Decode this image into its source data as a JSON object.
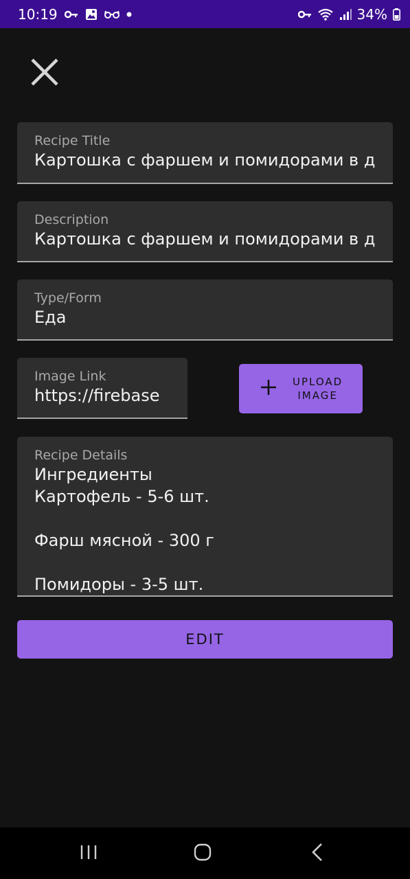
{
  "status_bar": {
    "time": "10:19",
    "battery": "34%",
    "icons_left": [
      "key-icon",
      "image-icon",
      "glasses-icon",
      "dot-icon"
    ],
    "icons_right": [
      "key-icon",
      "wifi-icon",
      "signal-icon",
      "battery-icon"
    ],
    "background_color": "#3b0e91"
  },
  "form": {
    "title": {
      "label": "Recipe Title",
      "value": "Картошка с фаршем и помидорами в д"
    },
    "description": {
      "label": "Description",
      "value": "Картошка с фаршем и помидорами в д"
    },
    "type": {
      "label": "Type/Form",
      "value": "Еда"
    },
    "image_link": {
      "label": "Image Link",
      "value": "https://firebase"
    },
    "upload_button": {
      "line1": "UPLOAD",
      "line2": "IMAGE",
      "icon": "plus-icon"
    },
    "details": {
      "label": "Recipe Details",
      "lines": [
        "Ингредиенты",
        "Картофель - 5-6 шт.",
        "",
        "Фарш мясной - 300 г",
        "",
        "Помидоры - 3-5 шт."
      ]
    },
    "edit_button": {
      "label": "EDIT"
    }
  },
  "colors": {
    "accent": "#9665e6",
    "background": "#131313",
    "field_background": "#2e2e2e"
  }
}
